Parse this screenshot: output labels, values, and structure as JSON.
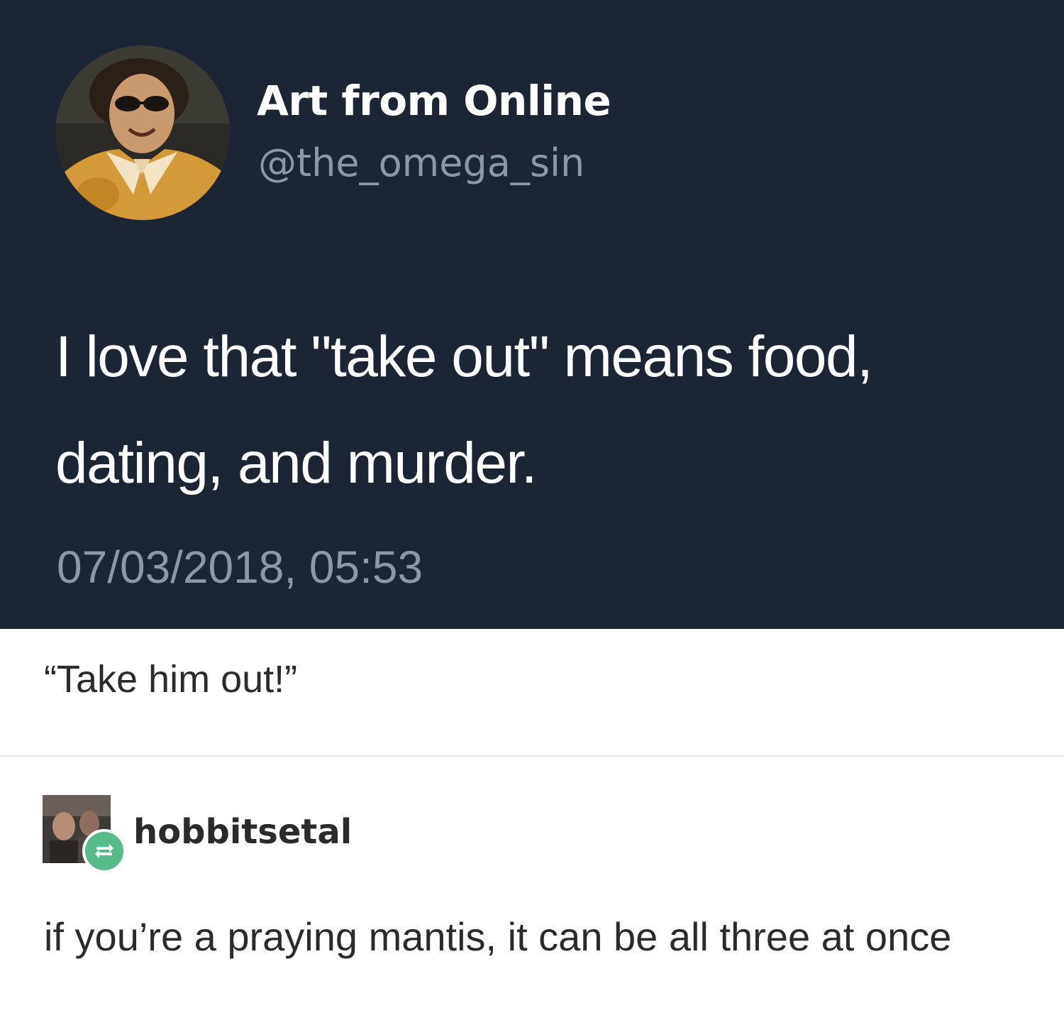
{
  "tweet": {
    "display_name": "Art from Online",
    "handle": "@the_omega_sin",
    "text": "I love that \"take out\" means food, dating, and murder.",
    "timestamp": "07/03/2018, 05:53",
    "avatar_icon": "profile-photo-man-sunglasses"
  },
  "tumblr": {
    "quote": "“Take him out!”",
    "reply": {
      "username": "hobbitsetal",
      "avatar_icon": "profile-photo",
      "badge_icon": "reblog-icon",
      "text": "if you’re a praying mantis, it can be all three at once"
    }
  },
  "colors": {
    "tweet_background": "#1c2534",
    "secondary_text": "#8b98a5",
    "reblog_green": "#56bc8a"
  }
}
